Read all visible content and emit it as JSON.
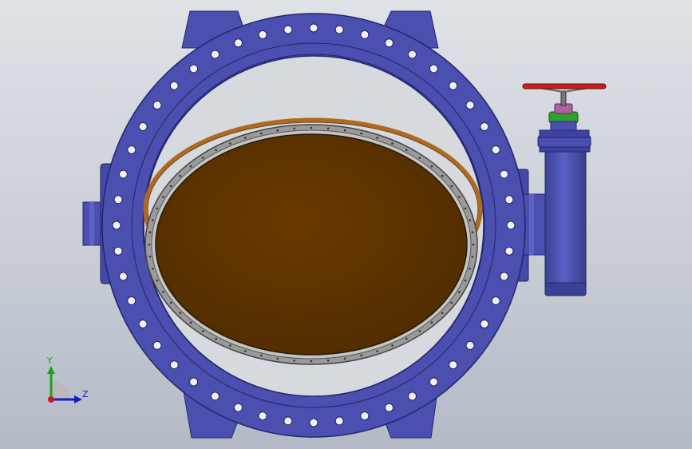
{
  "viewport": {
    "background": {
      "top": "#dfe2e6",
      "bottom": "#b3bac6"
    }
  },
  "model": {
    "type": "butterfly-valve",
    "body_color": "#4a4fb0",
    "disc_color": "#5a3200",
    "seat_color": "#b06a20",
    "gasket_color": "#8a8a8a",
    "handwheel_color": "#c82020",
    "hub_color": "#30a030",
    "cap_color": "#b060a0"
  },
  "triad": {
    "y_label": "Y",
    "z_label": "Z",
    "y_color": "#1aa31a",
    "z_color": "#1a1acc",
    "origin_color": "#cc1a1a"
  }
}
